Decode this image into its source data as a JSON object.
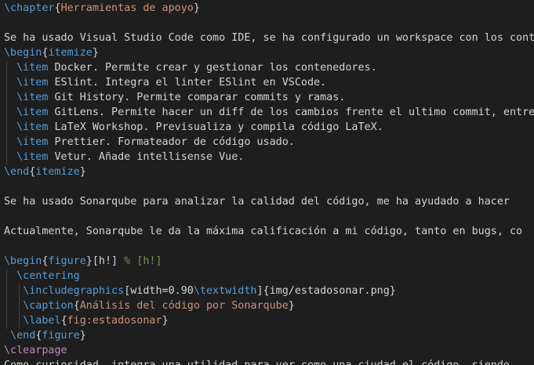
{
  "editor": {
    "language": "latex",
    "theme_colors": {
      "background": "#1e1e1e",
      "command": "#569cd6",
      "argument": "#ce9178",
      "text": "#d4d4d4",
      "comment": "#6a9955",
      "clearpage": "#c586c0"
    },
    "lines": [
      {
        "segments": [
          {
            "t": "\\chapter",
            "c": "kw"
          },
          {
            "t": "{",
            "c": "br"
          },
          {
            "t": "Herramientas de apoyo",
            "c": "arg"
          },
          {
            "t": "}",
            "c": "br"
          }
        ]
      },
      {
        "segments": []
      },
      {
        "segments": [
          {
            "t": "Se ha usado Visual Studio Code como IDE, se ha configurado un workspace con los contenedores",
            "c": "txt"
          }
        ]
      },
      {
        "segments": [
          {
            "t": "\\begin",
            "c": "kw"
          },
          {
            "t": "{",
            "c": "br"
          },
          {
            "t": "itemize",
            "c": "kw"
          },
          {
            "t": "}",
            "c": "br"
          }
        ]
      },
      {
        "segments": [
          {
            "t": "  ",
            "c": "txt"
          },
          {
            "t": "\\item",
            "c": "kw"
          },
          {
            "t": " Docker. Permite crear y gestionar los contenedores.",
            "c": "txt"
          }
        ]
      },
      {
        "segments": [
          {
            "t": "  ",
            "c": "txt"
          },
          {
            "t": "\\item",
            "c": "kw"
          },
          {
            "t": " ESlint. Integra el linter ESlint en VSCode.",
            "c": "txt"
          }
        ]
      },
      {
        "segments": [
          {
            "t": "  ",
            "c": "txt"
          },
          {
            "t": "\\item",
            "c": "kw"
          },
          {
            "t": " Git History. Permite comparar commits y ramas.",
            "c": "txt"
          }
        ]
      },
      {
        "segments": [
          {
            "t": "  ",
            "c": "txt"
          },
          {
            "t": "\\item",
            "c": "kw"
          },
          {
            "t": " GitLens. Permite hacer un diff de los cambios frente el ultimo commit, entre otras",
            "c": "txt"
          }
        ]
      },
      {
        "segments": [
          {
            "t": "  ",
            "c": "txt"
          },
          {
            "t": "\\item",
            "c": "kw"
          },
          {
            "t": " LaTeX Workshop. Previsualiza y compila código LaTeX.",
            "c": "txt"
          }
        ]
      },
      {
        "segments": [
          {
            "t": "  ",
            "c": "txt"
          },
          {
            "t": "\\item",
            "c": "kw"
          },
          {
            "t": " Prettier. Formateador de código usado.",
            "c": "txt"
          }
        ]
      },
      {
        "segments": [
          {
            "t": "  ",
            "c": "txt"
          },
          {
            "t": "\\item",
            "c": "kw"
          },
          {
            "t": " Vetur. Añade intellisense Vue.",
            "c": "txt"
          }
        ]
      },
      {
        "segments": [
          {
            "t": "\\end",
            "c": "kw"
          },
          {
            "t": "{",
            "c": "br"
          },
          {
            "t": "itemize",
            "c": "kw"
          },
          {
            "t": "}",
            "c": "br"
          }
        ]
      },
      {
        "segments": []
      },
      {
        "segments": [
          {
            "t": "Se ha usado Sonarqube para analizar la calidad del código, me ha ayudado a hacer",
            "c": "txt"
          }
        ]
      },
      {
        "segments": []
      },
      {
        "segments": [
          {
            "t": "Actualmente, Sonarqube le da la máxima calificación a mi código, tanto en bugs, co",
            "c": "txt"
          }
        ]
      },
      {
        "segments": []
      },
      {
        "segments": [
          {
            "t": "\\begin",
            "c": "kw"
          },
          {
            "t": "{",
            "c": "br"
          },
          {
            "t": "figure",
            "c": "kw"
          },
          {
            "t": "}",
            "c": "br"
          },
          {
            "t": "[h!]",
            "c": "txt"
          },
          {
            "t": " % [h!]",
            "c": "cm"
          }
        ]
      },
      {
        "segments": [
          {
            "t": "  ",
            "c": "txt"
          },
          {
            "t": "\\centering",
            "c": "kw"
          }
        ]
      },
      {
        "segments": [
          {
            "t": "   ",
            "c": "txt"
          },
          {
            "t": "\\includegraphics",
            "c": "kw"
          },
          {
            "t": "[width=0.90",
            "c": "txt"
          },
          {
            "t": "\\textwidth",
            "c": "kw"
          },
          {
            "t": "]{img/estadosonar.png}",
            "c": "txt"
          }
        ]
      },
      {
        "segments": [
          {
            "t": "   ",
            "c": "txt"
          },
          {
            "t": "\\caption",
            "c": "kw"
          },
          {
            "t": "{",
            "c": "br"
          },
          {
            "t": "Análisis del código por Sonarqube",
            "c": "arg"
          },
          {
            "t": "}",
            "c": "br"
          }
        ]
      },
      {
        "segments": [
          {
            "t": "   ",
            "c": "txt"
          },
          {
            "t": "\\label",
            "c": "kw"
          },
          {
            "t": "{",
            "c": "br"
          },
          {
            "t": "fig:estadosonar",
            "c": "arg"
          },
          {
            "t": "}",
            "c": "br"
          }
        ]
      },
      {
        "segments": [
          {
            "t": " ",
            "c": "txt"
          },
          {
            "t": "\\end",
            "c": "kw"
          },
          {
            "t": "{",
            "c": "br"
          },
          {
            "t": "figure",
            "c": "kw"
          },
          {
            "t": "}",
            "c": "br"
          }
        ]
      },
      {
        "segments": [
          {
            "t": "\\clearpage",
            "c": "cp"
          }
        ]
      },
      {
        "segments": [
          {
            "t": "Como curiosidad, integra una utilidad para ver como una ciudad el código, siendo",
            "c": "txt"
          }
        ]
      }
    ]
  }
}
